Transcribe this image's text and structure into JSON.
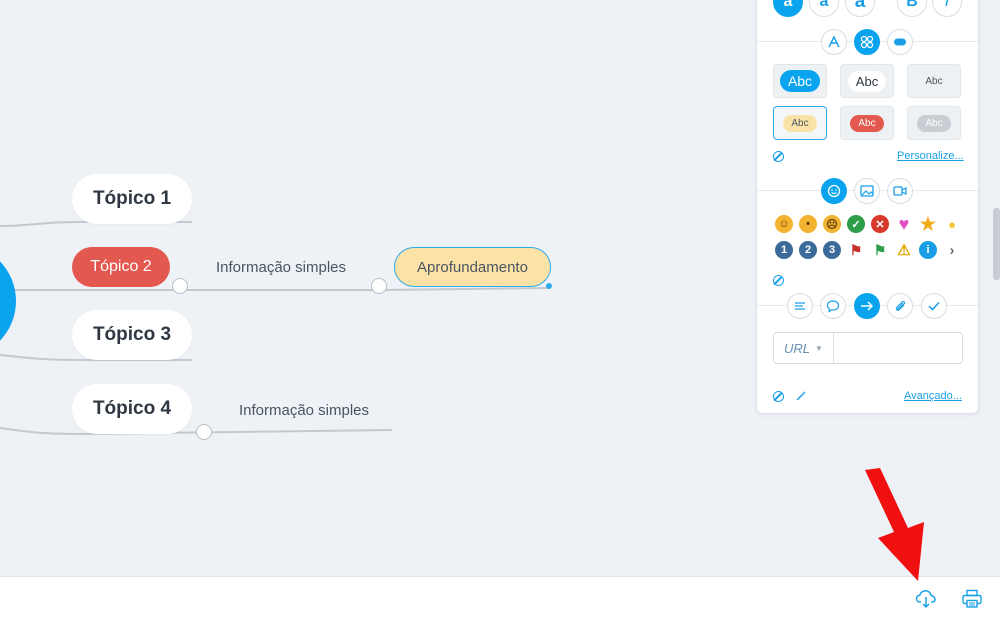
{
  "mindmap": {
    "topics": [
      {
        "label": "Tópico 1"
      },
      {
        "label": "Tópico 2"
      },
      {
        "label": "Tópico 3"
      },
      {
        "label": "Tópico 4"
      }
    ],
    "subtopic_2": "Informação simples",
    "subtopic_2_child": "Aprofundamento",
    "subtopic_4": "Informação simples"
  },
  "panel": {
    "font_buttons": [
      "a",
      "a",
      "a",
      "B",
      "I"
    ],
    "style_samples": [
      "Abc",
      "Abc",
      "Abc",
      "Abc",
      "Abc",
      "Abc"
    ],
    "customize_link": "Personalize...",
    "url_prefix": "URL",
    "url_value": "",
    "advanced_link": "Avançado...",
    "number_icons": [
      "1",
      "2",
      "3"
    ]
  },
  "colors": {
    "accent": "#0aa3ee",
    "topic_red": "#e3584f",
    "topic_yellow": "#fbe3a7",
    "canvas_bg": "#eef2f6"
  },
  "icons": {
    "bottom_bar": [
      "download-cloud-icon",
      "printer-icon"
    ],
    "annotation": "red-arrow-pointing-download"
  }
}
